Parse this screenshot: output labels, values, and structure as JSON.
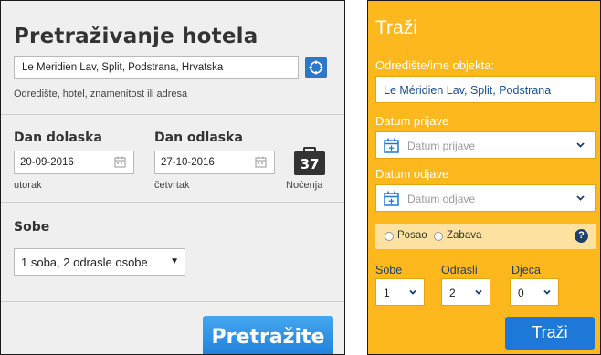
{
  "left_panel": {
    "title": "Pretraživanje hotela",
    "destination_value": "Le Meridien Lav, Split, Podstrana, Hrvatska",
    "destination_hint": "Odredište, hotel, znamenitost ili adresa",
    "checkin_label": "Dan dolaska",
    "checkin_value": "20-09-2016",
    "checkin_day": "utorak",
    "checkout_label": "Dan odlaska",
    "checkout_value": "27-10-2016",
    "checkout_day": "četvrtak",
    "nights_count": "37",
    "nights_label": "Noćenja",
    "rooms_label": "Sobe",
    "rooms_value": "1 soba, 2 odrasle osobe",
    "rooms_arrow": "▼",
    "search_button": "Pretražite"
  },
  "right_panel": {
    "title": "Traži",
    "destination_label": "Odredište/ime objekta:",
    "destination_value": "Le Méridien Lav, Split, Podstrana",
    "checkin_label": "Datum prijave",
    "checkin_placeholder": "Datum prijave",
    "checkout_label": "Datum odjave",
    "checkout_placeholder": "Datum odjave",
    "trip_business": "Posao",
    "trip_leisure": "Zabava",
    "help": "?",
    "rooms_label": "Sobe",
    "rooms_value": "1",
    "adults_label": "Odrasli",
    "adults_value": "2",
    "children_label": "Djeca",
    "children_value": "0",
    "search_button": "Traži"
  },
  "colors": {
    "accent_blue": "#1e78d8",
    "panel_yellow": "#fdb81e",
    "label_navy": "#1d3f6e"
  },
  "icons": {
    "locate": "compass-icon",
    "calendar": "calendar-icon",
    "nights": "suitcase-icon",
    "chevron": "chevron-down-icon",
    "help": "help-icon"
  }
}
